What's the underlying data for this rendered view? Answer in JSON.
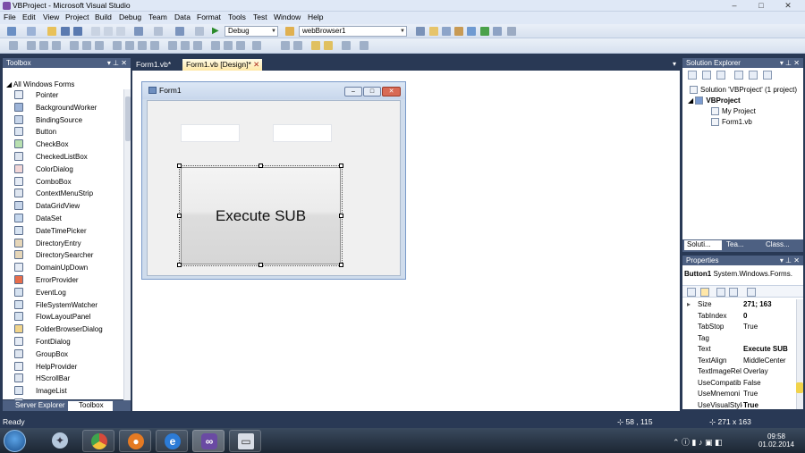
{
  "titlebar": {
    "title": "VBProject - Microsoft Visual Studio",
    "minimize": "–",
    "maximize": "□",
    "close": "✕"
  },
  "menu": [
    "File",
    "Edit",
    "View",
    "Project",
    "Build",
    "Debug",
    "Team",
    "Data",
    "Format",
    "Tools",
    "Test",
    "Window",
    "Help"
  ],
  "toolbar": {
    "config": "Debug",
    "target": "webBrowser1"
  },
  "toolbox": {
    "title": "Toolbox",
    "category": "All Windows Forms",
    "items": [
      "Pointer",
      "BackgroundWorker",
      "BindingSource",
      "Button",
      "CheckBox",
      "CheckedListBox",
      "ColorDialog",
      "ComboBox",
      "ContextMenuStrip",
      "DataGridView",
      "DataSet",
      "DateTimePicker",
      "DirectoryEntry",
      "DirectorySearcher",
      "DomainUpDown",
      "ErrorProvider",
      "EventLog",
      "FileSystemWatcher",
      "FlowLayoutPanel",
      "FolderBrowserDialog",
      "FontDialog",
      "GroupBox",
      "HelpProvider",
      "HScrollBar",
      "ImageList",
      "Label"
    ],
    "bottom_tabs": [
      "Server Explorer",
      "Toolbox"
    ]
  },
  "editor": {
    "tabs": [
      "Form1.vb*",
      "Form1.vb [Design]*"
    ],
    "close": "✕",
    "form_title": "Form1",
    "button_text": "Execute SUB"
  },
  "solution_explorer": {
    "title": "Solution Explorer",
    "solution": "Solution 'VBProject' (1 project)",
    "project": "VBProject",
    "children": [
      "My Project",
      "Form1.vb"
    ],
    "tabs": [
      "Soluti...",
      "Tea...",
      "Class..."
    ]
  },
  "properties": {
    "title": "Properties",
    "object": "Button1",
    "object_type": "System.Windows.Forms.",
    "rows": [
      {
        "name": "Size",
        "value": "271; 163",
        "bold": true
      },
      {
        "name": "TabIndex",
        "value": "0",
        "bold": true
      },
      {
        "name": "TabStop",
        "value": "True",
        "bold": false
      },
      {
        "name": "Tag",
        "value": "",
        "bold": false
      },
      {
        "name": "Text",
        "value": "Execute SUB",
        "bold": true
      },
      {
        "name": "TextAlign",
        "value": "MiddleCenter",
        "bold": false
      },
      {
        "name": "TextImageRel",
        "value": "Overlay",
        "bold": false
      },
      {
        "name": "UseCompatib",
        "value": "False",
        "bold": false
      },
      {
        "name": "UseMnemoni",
        "value": "True",
        "bold": false
      },
      {
        "name": "UseVisualStyle",
        "value": "True",
        "bold": true
      }
    ]
  },
  "status": {
    "text": "Ready",
    "position": "58 , 115",
    "size": "271 x 163"
  },
  "taskbar": {
    "time": "09:58",
    "date": "01.02.2014"
  }
}
